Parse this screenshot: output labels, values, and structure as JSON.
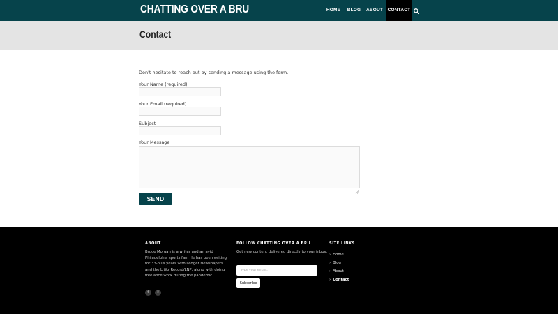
{
  "header": {
    "logo": "CHATTING OVER A BRU",
    "nav": [
      {
        "label": "HOME"
      },
      {
        "label": "BLOG"
      },
      {
        "label": "ABOUT"
      },
      {
        "label": "CONTACT",
        "active": true
      }
    ],
    "search_icon": "search-icon",
    "background": "#06434b",
    "active_background": "#000000"
  },
  "page": {
    "title": "Contact"
  },
  "form": {
    "intro": "Don't hesitate to reach out by sending a message using the form.",
    "name_label": "Your Name (required)",
    "name_value": "",
    "email_label": "Your Email (required)",
    "email_value": "",
    "subject_label": "Subject",
    "subject_value": "",
    "message_label": "Your Message",
    "message_value": "",
    "send_label": "SEND",
    "button_color": "#06434b"
  },
  "footer": {
    "about": {
      "heading": "ABOUT",
      "text": "Bruce Morgan is a writer and an avid Philadelphia sports fan. He has been writing for 33-plus years with Ledger Newspapers and the Lititz Record/LNP, along with doing freelance work during the pandemic.",
      "social": [
        {
          "icon": "facebook-icon",
          "glyph": "f"
        },
        {
          "icon": "x-twitter-icon",
          "glyph": "✕"
        }
      ]
    },
    "follow": {
      "heading": "FOLLOW CHATTING OVER A BRU",
      "text": "Get new content delivered directly to your inbox.",
      "email_placeholder": "Type your email…",
      "subscribe_label": "Subscribe"
    },
    "links": {
      "heading": "SITE LINKS",
      "items": [
        {
          "label": "Home"
        },
        {
          "label": "Blog"
        },
        {
          "label": "About"
        },
        {
          "label": "Contact",
          "current": true
        }
      ]
    },
    "background": "#000000"
  }
}
